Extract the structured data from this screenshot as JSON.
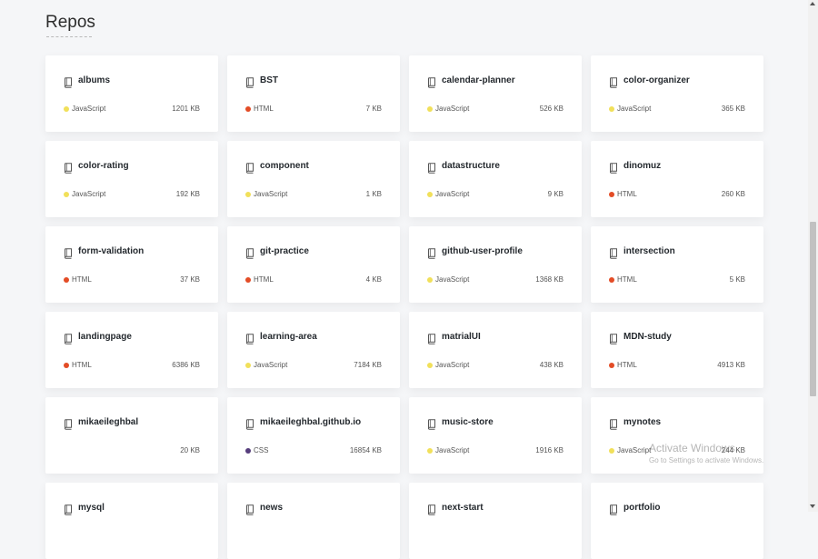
{
  "page": {
    "title": "Repos"
  },
  "colors": {
    "JavaScript": "#f1e05a",
    "HTML": "#e34c26",
    "CSS": "#563d7c"
  },
  "repos": [
    {
      "name": "albums",
      "language": "JavaScript",
      "size": "1201 KB"
    },
    {
      "name": "BST",
      "language": "HTML",
      "size": "7 KB"
    },
    {
      "name": "calendar-planner",
      "language": "JavaScript",
      "size": "526 KB"
    },
    {
      "name": "color-organizer",
      "language": "JavaScript",
      "size": "365 KB"
    },
    {
      "name": "color-rating",
      "language": "JavaScript",
      "size": "192 KB"
    },
    {
      "name": "component",
      "language": "JavaScript",
      "size": "1 KB"
    },
    {
      "name": "datastructure",
      "language": "JavaScript",
      "size": "9 KB"
    },
    {
      "name": "dinomuz",
      "language": "HTML",
      "size": "260 KB"
    },
    {
      "name": "form-validation",
      "language": "HTML",
      "size": "37 KB"
    },
    {
      "name": "git-practice",
      "language": "HTML",
      "size": "4 KB"
    },
    {
      "name": "github-user-profile",
      "language": "JavaScript",
      "size": "1368 KB"
    },
    {
      "name": "intersection",
      "language": "HTML",
      "size": "5 KB"
    },
    {
      "name": "landingpage",
      "language": "HTML",
      "size": "6386 KB"
    },
    {
      "name": "learning-area",
      "language": "JavaScript",
      "size": "7184 KB"
    },
    {
      "name": "matrialUI",
      "language": "JavaScript",
      "size": "438 KB"
    },
    {
      "name": "MDN-study",
      "language": "HTML",
      "size": "4913 KB"
    },
    {
      "name": "mikaeileghbal",
      "language": "",
      "size": "20 KB"
    },
    {
      "name": "mikaeileghbal.github.io",
      "language": "CSS",
      "size": "16854 KB"
    },
    {
      "name": "music-store",
      "language": "JavaScript",
      "size": "1916 KB"
    },
    {
      "name": "mynotes",
      "language": "JavaScript",
      "size": "244 KB"
    },
    {
      "name": "mysql",
      "language": "",
      "size": ""
    },
    {
      "name": "news",
      "language": "",
      "size": ""
    },
    {
      "name": "next-start",
      "language": "",
      "size": ""
    },
    {
      "name": "portfolio",
      "language": "",
      "size": ""
    }
  ],
  "watermark": {
    "title": "Activate Windows",
    "subtitle": "Go to Settings to activate Windows."
  }
}
